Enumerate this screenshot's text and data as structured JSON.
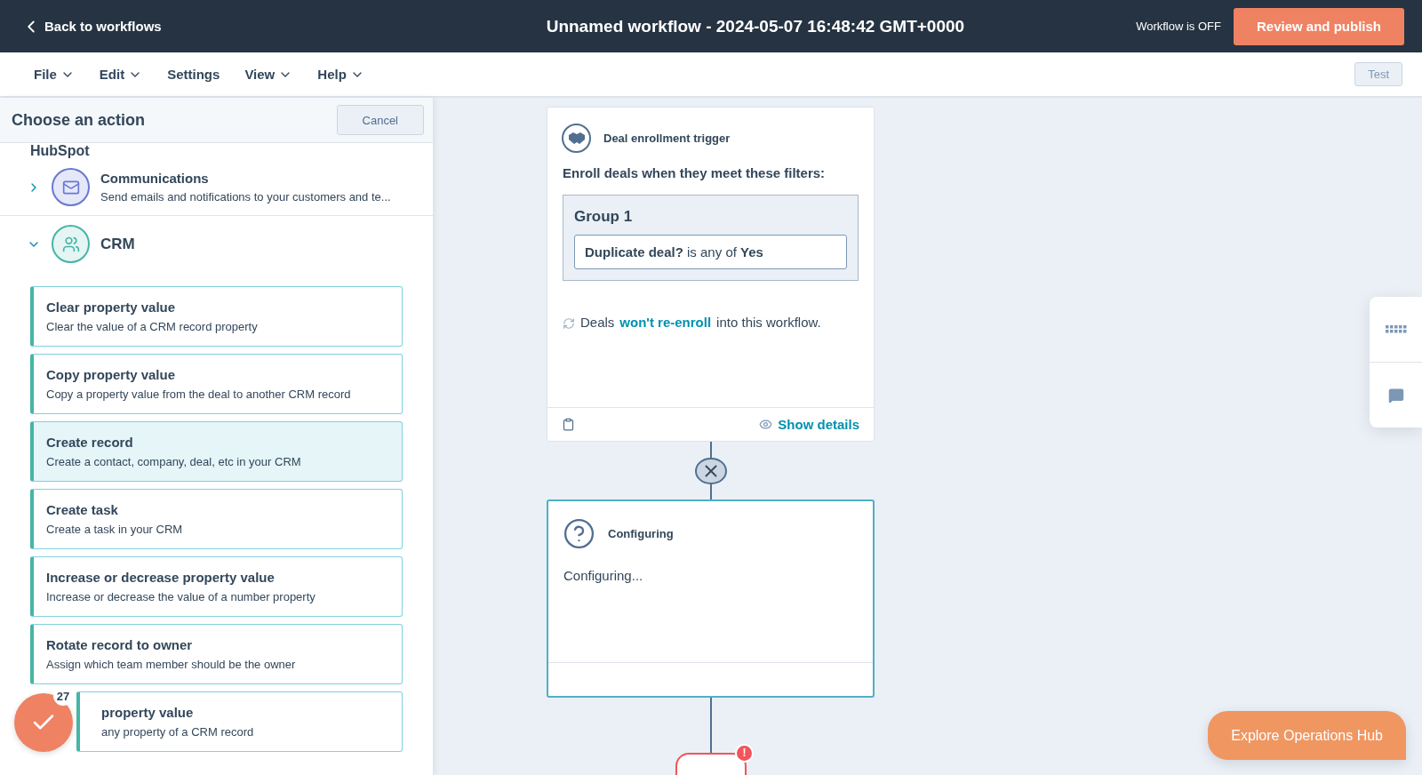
{
  "header": {
    "back_link": "Back to workflows",
    "title": "Unnamed workflow - 2024-05-07 16:48:42 GMT+0000",
    "status": "Workflow is OFF",
    "publish_button": "Review and publish"
  },
  "menu": {
    "items": [
      {
        "label": "File",
        "has_dropdown": true
      },
      {
        "label": "Edit",
        "has_dropdown": true
      },
      {
        "label": "Settings",
        "has_dropdown": false
      },
      {
        "label": "View",
        "has_dropdown": true
      },
      {
        "label": "Help",
        "has_dropdown": true
      }
    ],
    "test_button": "Test"
  },
  "panel": {
    "title": "Choose an action",
    "cancel_button": "Cancel",
    "section_heading": "HubSpot",
    "categories": [
      {
        "kind": "mail",
        "name": "Communications",
        "description": "Send emails and notifications to your customers and te...",
        "expanded": false
      },
      {
        "kind": "people",
        "name": "CRM",
        "expanded": true
      }
    ],
    "actions": [
      {
        "title": "Clear property value",
        "description": "Clear the value of a CRM record property",
        "selected": false
      },
      {
        "title": "Copy property value",
        "description": "Copy a property value from the deal to another CRM record",
        "selected": false
      },
      {
        "title": "Create record",
        "description": "Create a contact, company, deal, etc in your CRM",
        "selected": true
      },
      {
        "title": "Create task",
        "description": "Create a task in your CRM",
        "selected": false
      },
      {
        "title": "Increase or decrease property value",
        "description": "Increase or decrease the value of a number property",
        "selected": false
      },
      {
        "title": "Rotate record to owner",
        "description": "Assign which team member should be the owner",
        "selected": false
      },
      {
        "title": "property value",
        "description": "any property of a CRM record",
        "selected": false
      }
    ]
  },
  "task_badge": "27",
  "trigger": {
    "title": "Deal enrollment trigger",
    "intro": "Enroll deals when they meet these filters:",
    "group_title": "Group 1",
    "filter": "**Duplicate deal?** is any of **Yes**",
    "reenroll_before": "Deals",
    "reenroll_link": "won't re-enroll",
    "reenroll_after": "into this workflow.",
    "show_details": "Show details"
  },
  "step": {
    "title": "Configuring",
    "body": "Configuring..."
  },
  "end_node": {
    "badge": "!"
  },
  "explore_button": "Explore Operations Hub"
}
